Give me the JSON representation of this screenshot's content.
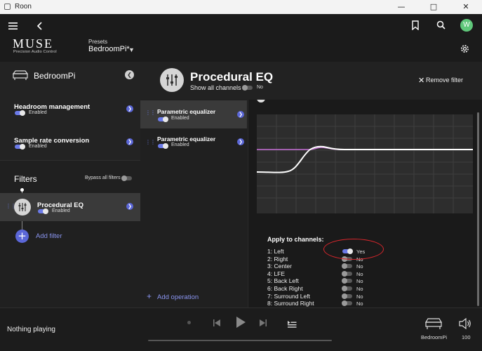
{
  "window": {
    "title": "Roon"
  },
  "header": {
    "brand": "MUSE",
    "brand_sub": "Precision Audio Control",
    "presets_label": "Presets",
    "presets_value": "BedroomPi*",
    "avatar_letter": "W"
  },
  "left": {
    "zone_name": "BedroomPi",
    "items": [
      {
        "title": "Headroom management",
        "status": "Enabled"
      },
      {
        "title": "Sample rate conversion",
        "status": "Enabled"
      }
    ],
    "filters_title": "Filters",
    "bypass_label": "Bypass all filters",
    "filter": {
      "title": "Procedural EQ",
      "status": "Enabled"
    },
    "add_filter": "Add filter"
  },
  "eq": {
    "title": "Procedural EQ",
    "show_all_label": "Show all channels",
    "show_all_value": "No",
    "remove_label": "Remove filter",
    "operations": [
      {
        "title": "Parametric equalizer",
        "status": "Enabled"
      },
      {
        "title": "Parametric equalizer",
        "status": "Enabled"
      }
    ],
    "add_operation": "Add operation",
    "apply_title": "Apply to channels:",
    "channels": [
      {
        "name": "1: Left",
        "value": "Yes",
        "on": true
      },
      {
        "name": "2: Right",
        "value": "No",
        "on": false
      },
      {
        "name": "3: Center",
        "value": "No",
        "on": false
      },
      {
        "name": "4: LFE",
        "value": "No",
        "on": false
      },
      {
        "name": "5: Back Left",
        "value": "No",
        "on": false
      },
      {
        "name": "6: Back Right",
        "value": "No",
        "on": false
      },
      {
        "name": "7: Surround Left",
        "value": "No",
        "on": false
      },
      {
        "name": "8: Surround Right",
        "value": "No",
        "on": false
      }
    ]
  },
  "player": {
    "now_playing": "Nothing playing",
    "zone": "BedroomPi",
    "volume": "100"
  },
  "colors": {
    "accent": "#6b7ae8",
    "highlight_circle": "#d9262c"
  }
}
